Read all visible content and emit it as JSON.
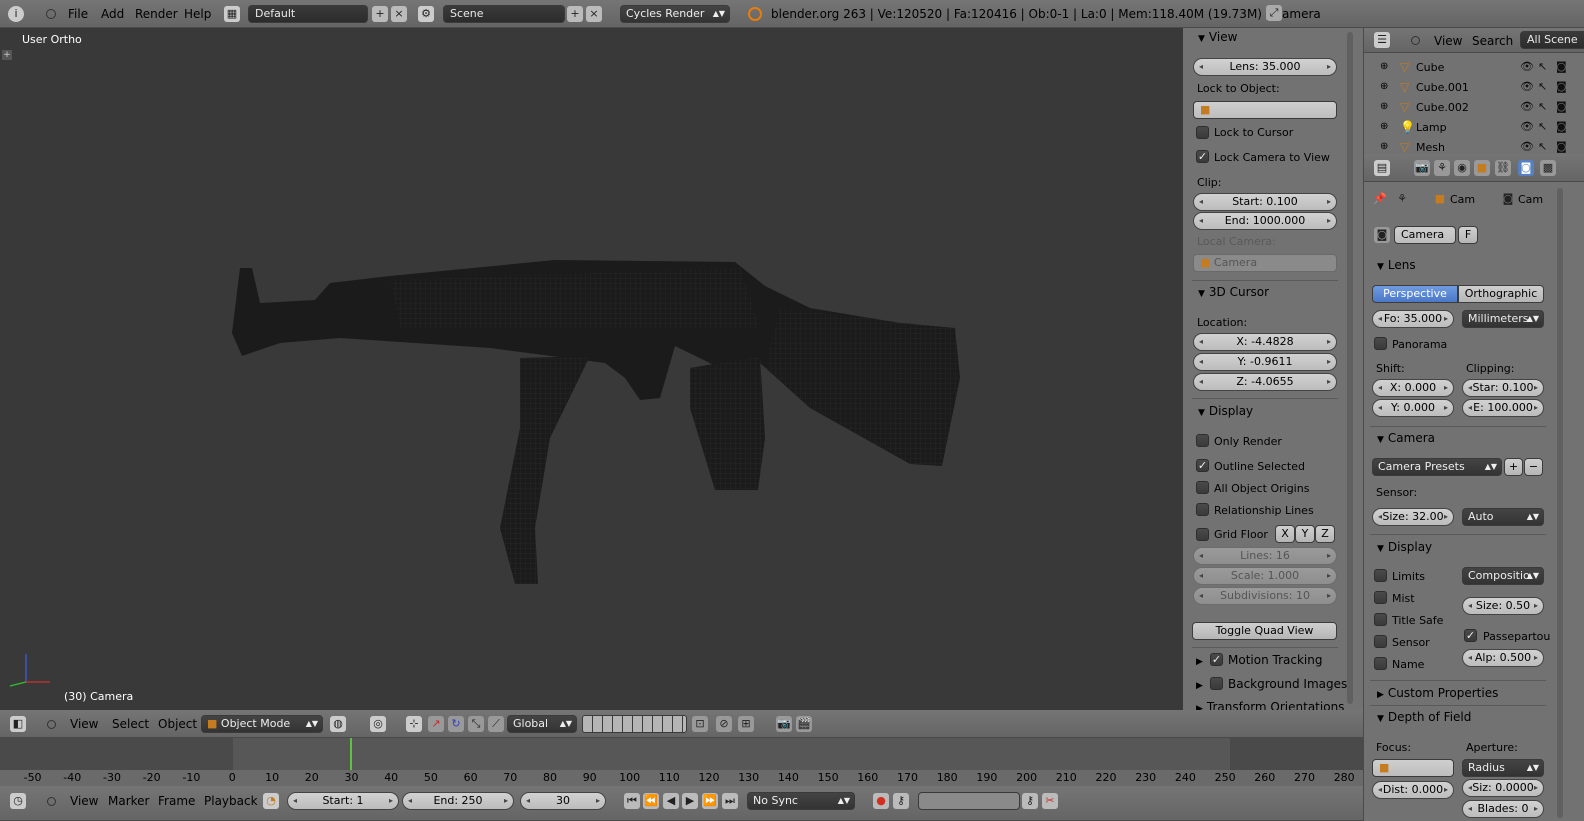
{
  "top_bar": {
    "menus": [
      "File",
      "Add",
      "Render",
      "Help"
    ],
    "screen_layout": "Default",
    "scene": "Scene",
    "render_engine": "Cycles Render",
    "status": "blender.org 263 | Ve:120520 | Fa:120416 | Ob:0-1 | La:0 | Mem:118.40M (19.73M) | Camera"
  },
  "viewport": {
    "view_name": "User Ortho",
    "object_label": "(30) Camera"
  },
  "view_panel": {
    "header": "View",
    "lens": "Lens: 35.000",
    "lock_to_object": "Lock to Object:",
    "lock_to_cursor": "Lock to Cursor",
    "lock_camera_to_view": "Lock Camera to View",
    "clip": "Clip:",
    "clip_start": "Start: 0.100",
    "clip_end": "End: 1000.000",
    "local_camera": "Local Camera:",
    "local_camera_value": "Camera"
  },
  "cursor_panel": {
    "header": "3D Cursor",
    "location": "Location:",
    "x": "X: -4.4828",
    "y": "Y: -0.9611",
    "z": "Z: -4.0655"
  },
  "display_panel": {
    "header": "Display",
    "only_render": "Only Render",
    "outline_selected": "Outline Selected",
    "all_object_origins": "All Object Origins",
    "relationship_lines": "Relationship Lines",
    "grid_floor": "Grid Floor",
    "axis_x": "X",
    "axis_y": "Y",
    "axis_z": "Z",
    "lines": "Lines: 16",
    "scale": "Scale: 1.000",
    "subdivisions": "Subdivisions: 10",
    "toggle_quad_view": "Toggle Quad View"
  },
  "collapsed_panels": {
    "motion_tracking": "Motion Tracking",
    "background_images": "Background Images",
    "transform_orientations": "Transform Orientations"
  },
  "outliner": {
    "menu_view": "View",
    "menu_search": "Search",
    "all_scenes": "All Scene",
    "items": [
      "Cube",
      "Cube.001",
      "Cube.002",
      "Lamp",
      "Mesh"
    ]
  },
  "properties": {
    "breadcrumb_1": "Cam",
    "breadcrumb_2": "Cam",
    "datablock": "Camera",
    "fake_user": "F",
    "lens_header": "Lens",
    "perspective": "Perspective",
    "orthographic": "Orthographic",
    "focal": "Fo: 35.000",
    "units": "Millimeters",
    "panorama": "Panorama",
    "shift": "Shift:",
    "clipping": "Clipping:",
    "shift_x": "X: 0.000",
    "shift_y": "Y: 0.000",
    "clip_start": "Star: 0.100",
    "clip_end": "E: 100.000",
    "camera_header": "Camera",
    "camera_presets": "Camera Presets",
    "sensor": "Sensor:",
    "sensor_size": "Size: 32.00",
    "sensor_fit": "Auto",
    "display_header": "Display",
    "limits": "Limits",
    "composition": "Compositio",
    "mist": "Mist",
    "size": "Size: 0.50",
    "title_safe": "Title Safe",
    "passepartout": "Passepartou",
    "sensor_cb": "Sensor",
    "alpha": "Alp: 0.500",
    "name_cb": "Name",
    "custom_properties": "Custom Properties",
    "dof_header": "Depth of Field",
    "focus": "Focus:",
    "aperture": "Aperture:",
    "radius": "Radius",
    "dist": "Dist: 0.000",
    "siz": "Siz: 0.0000",
    "blades": "Blades: 0"
  },
  "view3d_header": {
    "menus": [
      "View",
      "Select",
      "Object"
    ],
    "mode": "Object Mode",
    "orientation": "Global"
  },
  "timeline": {
    "ticks": [
      "-50",
      "-40",
      "-30",
      "-20",
      "-10",
      "0",
      "10",
      "20",
      "30",
      "40",
      "50",
      "60",
      "70",
      "80",
      "90",
      "100",
      "110",
      "120",
      "130",
      "140",
      "150",
      "160",
      "170",
      "180",
      "190",
      "200",
      "210",
      "220",
      "230",
      "240",
      "250",
      "260",
      "270",
      "280"
    ],
    "menus": [
      "View",
      "Marker",
      "Frame",
      "Playback"
    ],
    "start": "Start: 1",
    "end": "End: 250",
    "current": "30",
    "sync": "No Sync"
  },
  "colors": {
    "viewport_bg": "#393939",
    "panel_bg": "#727272",
    "selected_blue": "#5680c2",
    "current_frame": "#60c040"
  }
}
